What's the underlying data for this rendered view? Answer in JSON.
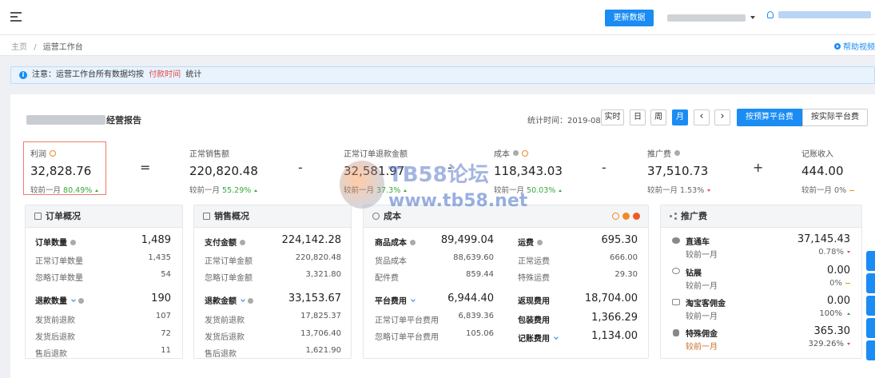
{
  "topbar": {
    "update_button": "更新数据"
  },
  "breadcrumb": {
    "home": "主页",
    "separator": "/",
    "current": "运营工作台",
    "help": "帮助视频"
  },
  "notice": {
    "icon": "i",
    "prefix": "注意：运营工作台所有数据均按",
    "highlight": "付款时间",
    "suffix": "统计"
  },
  "report": {
    "title_suffix": "经营报告",
    "time_label": "统计时间：2019-08",
    "buttons": [
      "实时",
      "日",
      "周",
      "月"
    ],
    "active_button": "月",
    "prev": "‹",
    "next": "›",
    "budget_tab": "按预算平台费",
    "actual_tab": "按实际平台费"
  },
  "metrics": [
    {
      "label": "利润",
      "value": "32,828.76",
      "cmp_label": "较前一月",
      "cmp": "80.49%",
      "trend": "up"
    },
    {
      "label": "正常销售额",
      "value": "220,820.48",
      "cmp_label": "较前一月",
      "cmp": "55.29%",
      "trend": "up"
    },
    {
      "label": "正常订单退款金额",
      "value": "32,581.97",
      "cmp_label": "较前一月",
      "cmp": "37.3%",
      "trend": "up"
    },
    {
      "label": "成本",
      "value": "118,343.03",
      "cmp_label": "较前一月",
      "cmp": "50.03%",
      "trend": "up"
    },
    {
      "label": "推广费",
      "value": "37,510.73",
      "cmp_label": "较前一月",
      "cmp": "1.53%",
      "trend": "down"
    },
    {
      "label": "记账收入",
      "value": "444.00",
      "cmp_label": "较前一月",
      "cmp": "0%",
      "trend": "flat"
    }
  ],
  "operators": [
    "=",
    "-",
    "-",
    "-",
    "+"
  ],
  "orders": {
    "title": "订单概况",
    "rows": [
      {
        "label": "订单数量",
        "value": "1,489"
      },
      {
        "label": "正常订单数量",
        "value": "1,435"
      },
      {
        "label": "忽略订单数量",
        "value": "54"
      },
      {
        "label": "退款数量",
        "value": "190"
      },
      {
        "label": "发货前退款",
        "value": "107"
      },
      {
        "label": "发货后退款",
        "value": "72"
      },
      {
        "label": "售后退款",
        "value": "11"
      }
    ]
  },
  "sales": {
    "title": "销售概况",
    "rows": [
      {
        "label": "支付金额",
        "value": "224,142.28"
      },
      {
        "label": "正常订单金额",
        "value": "220,820.48"
      },
      {
        "label": "忽略订单金额",
        "value": "3,321.80"
      },
      {
        "label": "退款金额",
        "value": "33,153.67"
      },
      {
        "label": "发货前退款",
        "value": "17,825.37"
      },
      {
        "label": "发货后退款",
        "value": "13,706.40"
      },
      {
        "label": "售后退款",
        "value": "1,621.90"
      }
    ]
  },
  "cost": {
    "title": "成本",
    "left": [
      {
        "label": "商品成本",
        "value": "89,499.04"
      },
      {
        "label": "货品成本",
        "value": "88,639.60"
      },
      {
        "label": "配件费",
        "value": "859.44"
      },
      {
        "label": "平台费用",
        "value": "6,944.40"
      },
      {
        "label": "正常订单平台费用",
        "value": "6,839.36"
      },
      {
        "label": "忽略订单平台费用",
        "value": "105.06"
      }
    ],
    "right": [
      {
        "label": "运费",
        "value": "695.30"
      },
      {
        "label": "正常运费",
        "value": "666.00"
      },
      {
        "label": "特殊运费",
        "value": "29.30"
      },
      {
        "label": "返现费用",
        "value": "18,704.00"
      },
      {
        "label": "包装费用",
        "value": "1,366.29"
      },
      {
        "label": "记账费用",
        "value": "1,134.00"
      }
    ]
  },
  "promo": {
    "title": "推广费",
    "items": [
      {
        "label": "直通车",
        "value": "37,145.43",
        "cmp_label": "较前一月",
        "cmp": "0.78%",
        "trend": "down"
      },
      {
        "label": "钻展",
        "value": "0.00",
        "cmp_label": "较前一月",
        "cmp": "0%",
        "trend": "flat"
      },
      {
        "label": "淘宝客佣金",
        "value": "0.00",
        "cmp_label": "较前一月",
        "cmp": "100%",
        "trend": "up"
      },
      {
        "label": "特殊佣金",
        "value": "365.30",
        "cmp_label": "较前一月",
        "cmp": "329.26%",
        "trend": "down"
      }
    ]
  },
  "watermark": {
    "line1": "TB58论坛",
    "line2": "www.tb58.net"
  },
  "colors": {
    "accent": "#1a8cf3",
    "up": "#3aa83a",
    "down": "#e24a4a",
    "highlight_border": "#f07a6c"
  }
}
